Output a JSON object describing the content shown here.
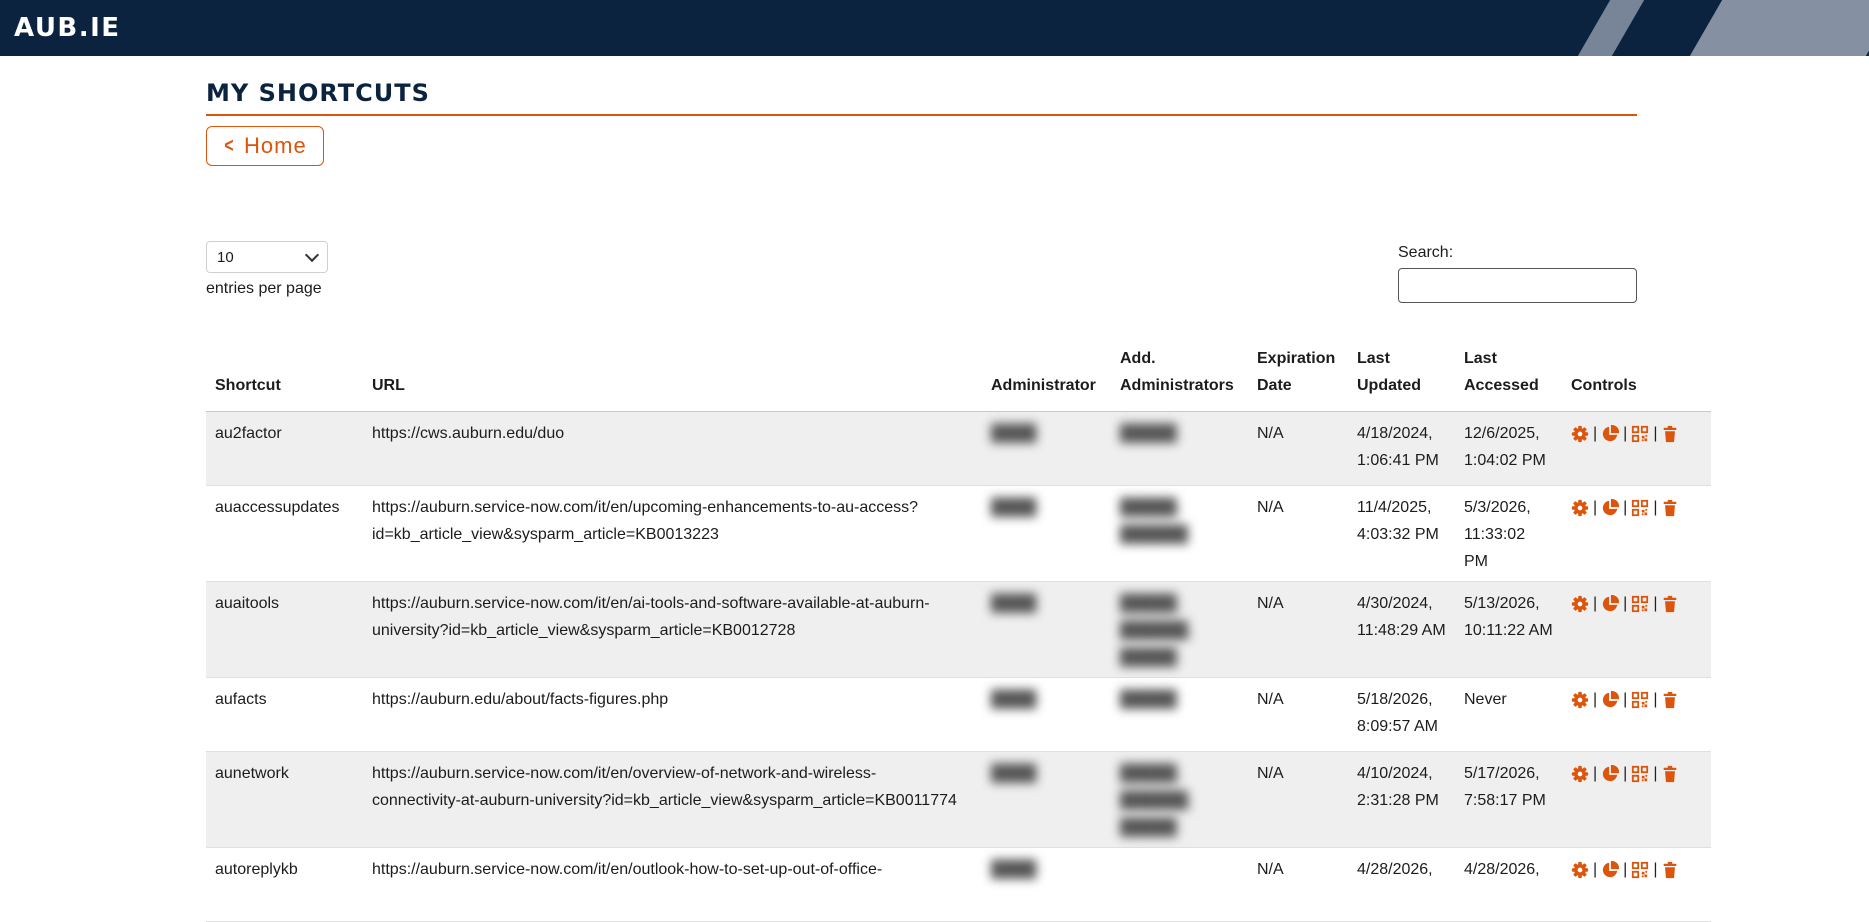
{
  "header": {
    "brand": "AUB.IE"
  },
  "page": {
    "title": "MY SHORTCUTS",
    "home_label": "Home"
  },
  "controls": {
    "page_length": "10",
    "page_length_label": "entries per page",
    "search_label": "Search:",
    "search_value": ""
  },
  "table": {
    "headers": {
      "shortcut": "Shortcut",
      "url": "URL",
      "administrator": "Administrator",
      "add_admins_line1": "Add.",
      "add_admins_line2": "Administrators",
      "expiration_line1": "Expiration",
      "expiration_line2": "Date",
      "updated_line1": "Last",
      "updated_line2": "Updated",
      "accessed_line1": "Last",
      "accessed_line2": "Accessed",
      "controls": "Controls"
    },
    "rows": [
      {
        "shortcut": "au2factor",
        "url_line1": "https://cws.auburn.edu/duo",
        "url_line2": "",
        "administrator": "████",
        "add_admins_line1": "█████",
        "add_admins_line2": "",
        "expiration": "N/A",
        "updated_line1": "4/18/2024,",
        "updated_line2": "1:06:41 PM",
        "accessed_line1": "12/6/2025,",
        "accessed_line2": "1:04:02 PM"
      },
      {
        "shortcut": "auaccessupdates",
        "url_line1": "https://auburn.service-now.com/it/en/upcoming-enhancements-to-au-access?",
        "url_line2": "id=kb_article_view&sysparm_article=KB0013223",
        "administrator": "████",
        "add_admins_line1": "█████, ██████",
        "add_admins_line2": "",
        "expiration": "N/A",
        "updated_line1": "11/4/2025,",
        "updated_line2": "4:03:32 PM",
        "accessed_line1": "5/3/2026,",
        "accessed_line2": "11:33:02 PM"
      },
      {
        "shortcut": "auaitools",
        "url_line1": "https://auburn.service-now.com/it/en/ai-tools-and-software-available-at-auburn-",
        "url_line2": "university?id=kb_article_view&sysparm_article=KB0012728",
        "administrator": "████",
        "add_admins_line1": "█████, ██████,",
        "add_admins_line2": "█████",
        "expiration": "N/A",
        "updated_line1": "4/30/2024,",
        "updated_line2": "11:48:29 AM",
        "accessed_line1": "5/13/2026,",
        "accessed_line2": "10:11:22 AM"
      },
      {
        "shortcut": "aufacts",
        "url_line1": "https://auburn.edu/about/facts-figures.php",
        "url_line2": "",
        "administrator": "████",
        "add_admins_line1": "█████",
        "add_admins_line2": "",
        "expiration": "N/A",
        "updated_line1": "5/18/2026,",
        "updated_line2": "8:09:57 AM",
        "accessed_line1": "Never",
        "accessed_line2": ""
      },
      {
        "shortcut": "aunetwork",
        "url_line1": "https://auburn.service-now.com/it/en/overview-of-network-and-wireless-",
        "url_line2": "connectivity-at-auburn-university?id=kb_article_view&sysparm_article=KB0011774",
        "administrator": "████",
        "add_admins_line1": "█████, ██████,",
        "add_admins_line2": "█████",
        "expiration": "N/A",
        "updated_line1": "4/10/2024,",
        "updated_line2": "2:31:28 PM",
        "accessed_line1": "5/17/2026,",
        "accessed_line2": "7:58:17 PM"
      },
      {
        "shortcut": "autoreplykb",
        "url_line1": "https://auburn.service-now.com/it/en/outlook-how-to-set-up-out-of-office-",
        "url_line2": "",
        "administrator": "████",
        "add_admins_line1": "",
        "add_admins_line2": "",
        "expiration": "N/A",
        "updated_line1": "4/28/2026,",
        "updated_line2": "",
        "accessed_line1": "4/28/2026,",
        "accessed_line2": ""
      }
    ]
  },
  "icons": {
    "settings": "gear-icon",
    "stats": "pie-chart-icon",
    "qr": "qr-code-icon",
    "delete": "trash-icon"
  },
  "colors": {
    "header_bg": "#0c2340",
    "accent": "#dd550c",
    "stripe": "#8c97a8",
    "row_alt": "#efefef"
  }
}
